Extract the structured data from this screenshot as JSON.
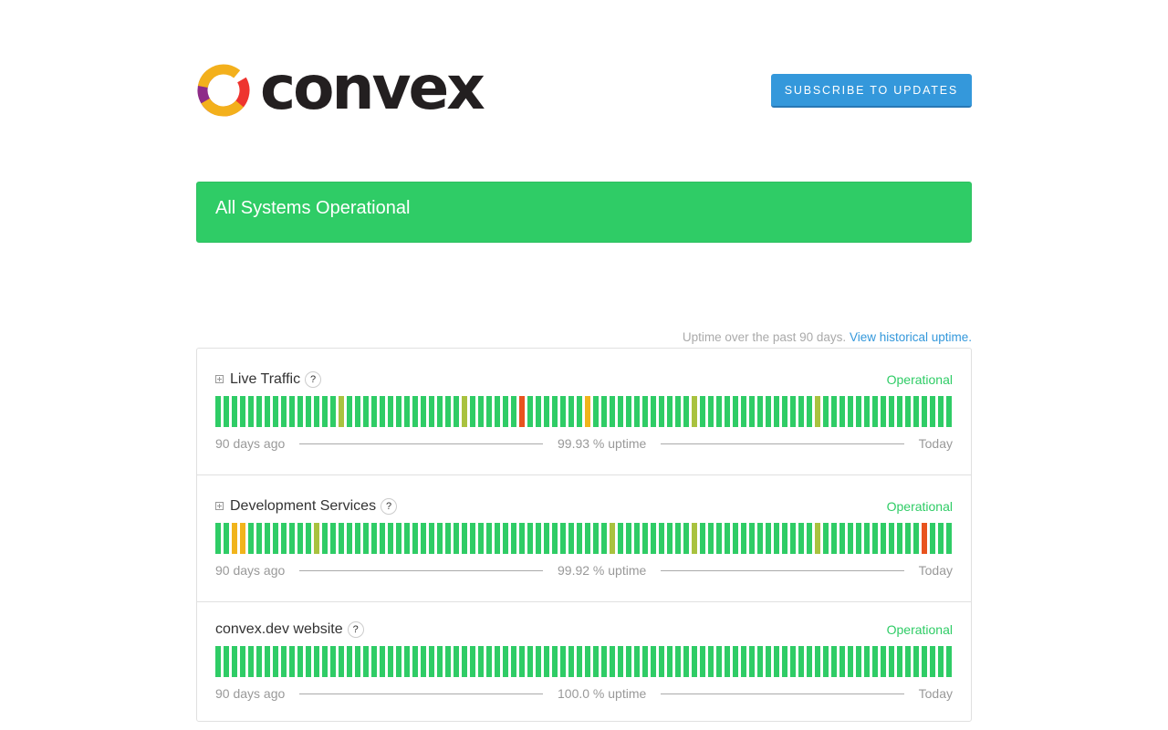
{
  "brand": {
    "name": "convex",
    "logo_colors": [
      "#8e2b88",
      "#ee342f",
      "#f3b01c"
    ]
  },
  "header": {
    "subscribe_label": "SUBSCRIBE TO UPDATES"
  },
  "banner": {
    "text": "All Systems Operational",
    "color": "#2fcc66"
  },
  "uptime_caption": {
    "text": "Uptime over the past 90 days.",
    "link": "View historical uptime."
  },
  "colors": {
    "operational": "#2fcc66",
    "minor": "#a9c23f",
    "degraded": "#f1b41c",
    "major": "#e8531e"
  },
  "components": [
    {
      "name": "Live Traffic",
      "expandable": true,
      "status": "Operational",
      "uptime": "99.93 % uptime",
      "left_label": "90 days ago",
      "right_label": "Today",
      "days": [
        0,
        0,
        0,
        0,
        0,
        0,
        0,
        0,
        0,
        0,
        0,
        0,
        0,
        0,
        0,
        1,
        0,
        0,
        0,
        0,
        0,
        0,
        0,
        0,
        0,
        0,
        0,
        0,
        0,
        0,
        1,
        0,
        0,
        0,
        0,
        0,
        0,
        3,
        0,
        0,
        0,
        0,
        0,
        0,
        0,
        2,
        0,
        0,
        0,
        0,
        0,
        0,
        0,
        0,
        0,
        0,
        0,
        0,
        1,
        0,
        0,
        0,
        0,
        0,
        0,
        0,
        0,
        0,
        0,
        0,
        0,
        0,
        0,
        1,
        0,
        0,
        0,
        0,
        0,
        0,
        0,
        0,
        0,
        0,
        0,
        0,
        0,
        0,
        0,
        0
      ]
    },
    {
      "name": "Development Services",
      "expandable": true,
      "status": "Operational",
      "uptime": "99.92 % uptime",
      "left_label": "90 days ago",
      "right_label": "Today",
      "days": [
        0,
        0,
        2,
        2,
        0,
        0,
        0,
        0,
        0,
        0,
        0,
        0,
        1,
        0,
        0,
        0,
        0,
        0,
        0,
        0,
        0,
        0,
        0,
        0,
        0,
        0,
        0,
        0,
        0,
        0,
        0,
        0,
        0,
        0,
        0,
        0,
        0,
        0,
        0,
        0,
        0,
        0,
        0,
        0,
        0,
        0,
        0,
        0,
        1,
        0,
        0,
        0,
        0,
        0,
        0,
        0,
        0,
        0,
        1,
        0,
        0,
        0,
        0,
        0,
        0,
        0,
        0,
        0,
        0,
        0,
        0,
        0,
        0,
        1,
        0,
        0,
        0,
        0,
        0,
        0,
        0,
        0,
        0,
        0,
        0,
        0,
        3,
        0,
        0,
        0
      ]
    },
    {
      "name": "convex.dev website",
      "expandable": false,
      "status": "Operational",
      "uptime": "100.0 % uptime",
      "left_label": "90 days ago",
      "right_label": "Today",
      "days": [
        0,
        0,
        0,
        0,
        0,
        0,
        0,
        0,
        0,
        0,
        0,
        0,
        0,
        0,
        0,
        0,
        0,
        0,
        0,
        0,
        0,
        0,
        0,
        0,
        0,
        0,
        0,
        0,
        0,
        0,
        0,
        0,
        0,
        0,
        0,
        0,
        0,
        0,
        0,
        0,
        0,
        0,
        0,
        0,
        0,
        0,
        0,
        0,
        0,
        0,
        0,
        0,
        0,
        0,
        0,
        0,
        0,
        0,
        0,
        0,
        0,
        0,
        0,
        0,
        0,
        0,
        0,
        0,
        0,
        0,
        0,
        0,
        0,
        0,
        0,
        0,
        0,
        0,
        0,
        0,
        0,
        0,
        0,
        0,
        0,
        0,
        0,
        0,
        0,
        0
      ]
    }
  ]
}
